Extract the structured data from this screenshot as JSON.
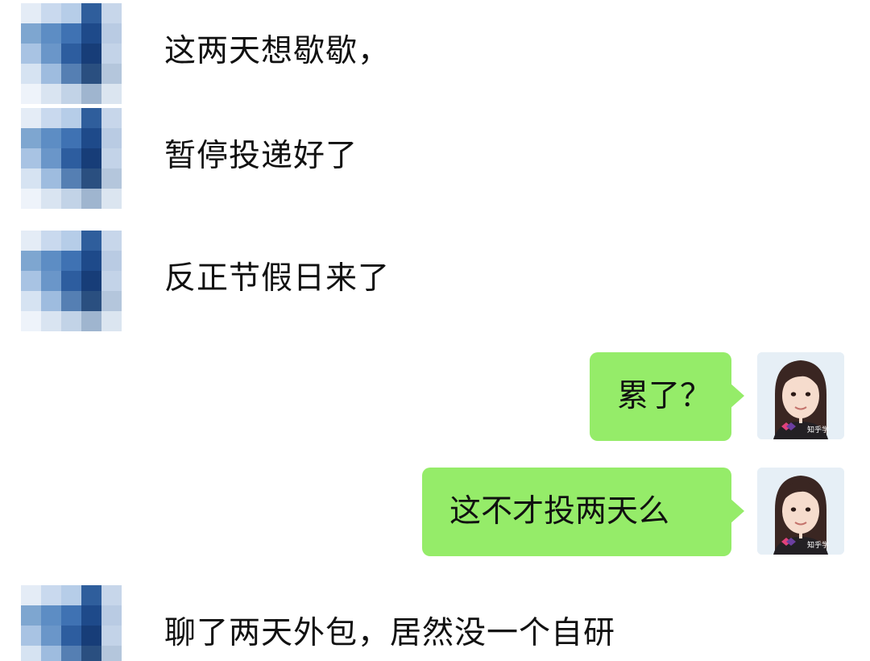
{
  "chat": {
    "messages": [
      {
        "side": "left",
        "text": "这两天想歇歇，"
      },
      {
        "side": "left",
        "text": "暂停投递好了"
      },
      {
        "side": "left",
        "text": "反正节假日来了"
      },
      {
        "side": "right",
        "text": "累了？"
      },
      {
        "side": "right",
        "text": "这不才投两天么"
      },
      {
        "side": "left",
        "text": "聊了两天外包，居然没一个自研"
      }
    ],
    "my_avatar": {
      "icon": "user-avatar-photo",
      "watermark_text": "知乎学"
    },
    "other_avatar": {
      "icon": "pixelated-avatar"
    },
    "colors": {
      "bubble_outgoing": "#95ec69",
      "background": "#ffffff",
      "text": "#111111"
    }
  }
}
